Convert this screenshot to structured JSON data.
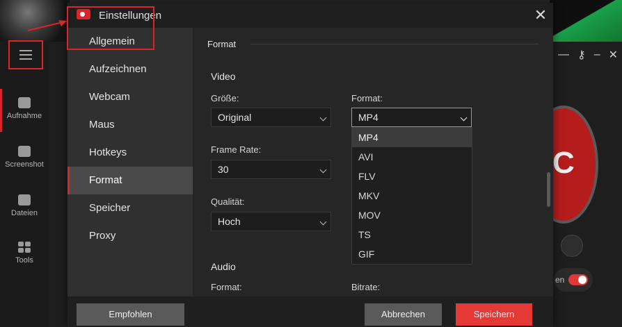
{
  "background_app": {
    "sidebar": [
      {
        "label": "Aufnahme",
        "icon": "camera-icon"
      },
      {
        "label": "Screenshot",
        "icon": "photo-camera-icon"
      },
      {
        "label": "Dateien",
        "icon": "folder-icon"
      },
      {
        "label": "Tools",
        "icon": "grid-icon"
      }
    ],
    "rec_label": "C",
    "toggle_label": "en"
  },
  "dialog": {
    "title": "Einstellungen",
    "close": "✕"
  },
  "nav": {
    "items": [
      {
        "label": "Allgemein"
      },
      {
        "label": "Aufzeichnen"
      },
      {
        "label": "Webcam"
      },
      {
        "label": "Maus"
      },
      {
        "label": "Hotkeys"
      },
      {
        "label": "Format"
      },
      {
        "label": "Speicher"
      },
      {
        "label": "Proxy"
      }
    ],
    "active": "Format"
  },
  "content": {
    "section_title": "Format",
    "video": {
      "heading": "Video",
      "size_label": "Größe:",
      "size_value": "Original",
      "format_label": "Format:",
      "format_value": "MP4",
      "framerate_label": "Frame Rate:",
      "framerate_value": "30",
      "quality_label": "Qualität:",
      "quality_value": "Hoch"
    },
    "audio": {
      "heading": "Audio",
      "format_label": "Format:",
      "bitrate_label": "Bitrate:"
    },
    "format_options": [
      "MP4",
      "AVI",
      "FLV",
      "MKV",
      "MOV",
      "TS",
      "GIF"
    ]
  },
  "footer": {
    "recommended": "Empfohlen",
    "cancel": "Abbrechen",
    "save": "Speichern"
  },
  "colors": {
    "accent": "#d9262b",
    "save_button": "#e53935"
  }
}
